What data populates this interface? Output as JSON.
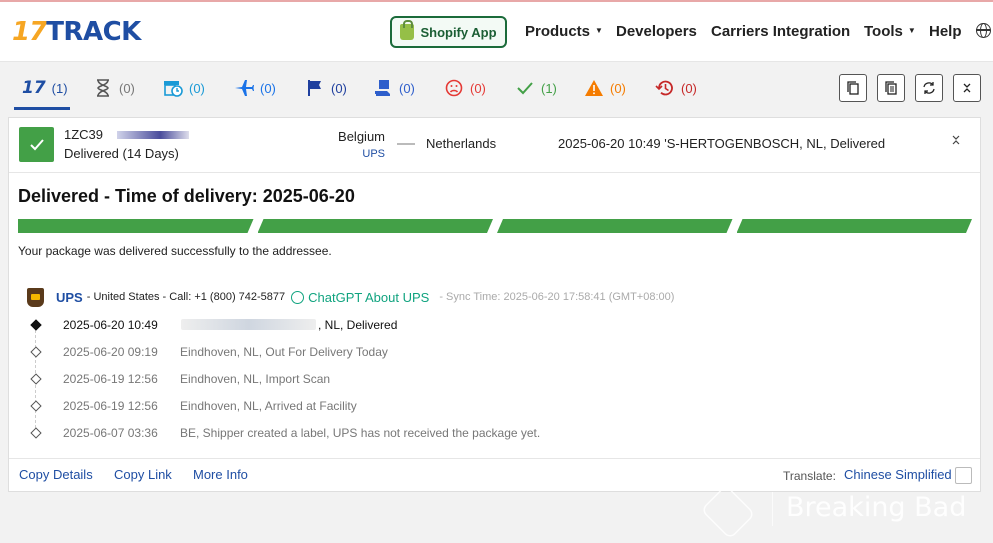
{
  "header": {
    "logo": "17TRACK",
    "shopify_label": "Shopify App",
    "nav": [
      {
        "label": "Products",
        "dropdown": true
      },
      {
        "label": "Developers",
        "dropdown": false
      },
      {
        "label": "Carriers Integration",
        "dropdown": false
      },
      {
        "label": "Tools",
        "dropdown": true
      },
      {
        "label": "Help",
        "dropdown": false
      }
    ]
  },
  "tabs": [
    {
      "name": "all",
      "icon": "17-logo-icon",
      "count": "(1)",
      "color": "#1f4ea3"
    },
    {
      "name": "not-found",
      "icon": "hourglass-icon",
      "count": "(0)",
      "color": "#777777"
    },
    {
      "name": "info-received",
      "icon": "truck-clock-icon",
      "count": "(0)",
      "color": "#1a9ad6"
    },
    {
      "name": "in-transit",
      "icon": "plane-icon",
      "count": "(0)",
      "color": "#1a73e8"
    },
    {
      "name": "pick-up",
      "icon": "flag-icon",
      "count": "(0)",
      "color": "#1f3f9e"
    },
    {
      "name": "out-for-delivery",
      "icon": "delivery-icon",
      "count": "(0)",
      "color": "#2e5ecb"
    },
    {
      "name": "undelivered",
      "icon": "sad-face-icon",
      "count": "(0)",
      "color": "#e53935"
    },
    {
      "name": "delivered",
      "icon": "check-icon",
      "count": "(1)",
      "color": "#43a047"
    },
    {
      "name": "alert",
      "icon": "warning-icon",
      "count": "(0)",
      "color": "#f57c00"
    },
    {
      "name": "expired",
      "icon": "history-icon",
      "count": "(0)",
      "color": "#c62828"
    }
  ],
  "toolbar_icons": [
    "copy-icon",
    "copy-list-icon",
    "refresh-icon",
    "collapse-icon"
  ],
  "shipment": {
    "tracking_prefix": "1ZC39",
    "status_line": "Delivered (14 Days)",
    "origin": "Belgium",
    "carrier": "UPS",
    "destination": "Netherlands",
    "last_event": "2025-06-20 10:49  'S-HERTOGENBOSCH, NL, Delivered",
    "delivered_title": "Delivered - Time of delivery:  2025-06-20",
    "progress_segments": 4,
    "progress_fraction": 1.0,
    "delivered_msg": "Your package was delivered successfully to the addressee.",
    "carrier_name": "UPS",
    "carrier_info": "- United States - Call:  +1 (800) 742-5877",
    "chatgpt_label": "ChatGPT About UPS",
    "sync_time": "- Sync Time: 2025-06-20 17:58:41 (GMT+08:00)",
    "events": [
      {
        "time": "2025-06-20 10:49",
        "desc": ", NL, Delivered"
      },
      {
        "time": "2025-06-20 09:19",
        "desc": "Eindhoven, NL, Out For Delivery Today"
      },
      {
        "time": "2025-06-19 12:56",
        "desc": "Eindhoven, NL, Import Scan"
      },
      {
        "time": "2025-06-19 12:56",
        "desc": "Eindhoven, NL, Arrived at Facility"
      },
      {
        "time": "2025-06-07 03:36",
        "desc": "BE, Shipper created a label, UPS has not received the package yet."
      }
    ]
  },
  "footer": {
    "copy_details": "Copy Details",
    "copy_link": "Copy Link",
    "more_info": "More Info",
    "translate_label": "Translate:",
    "translate_value": "Chinese Simplified"
  },
  "watermark": "Breaking Bad",
  "colors": {
    "brand_blue": "#1f4ea3",
    "brand_orange": "#f6a623",
    "delivered_green": "#43a047"
  }
}
